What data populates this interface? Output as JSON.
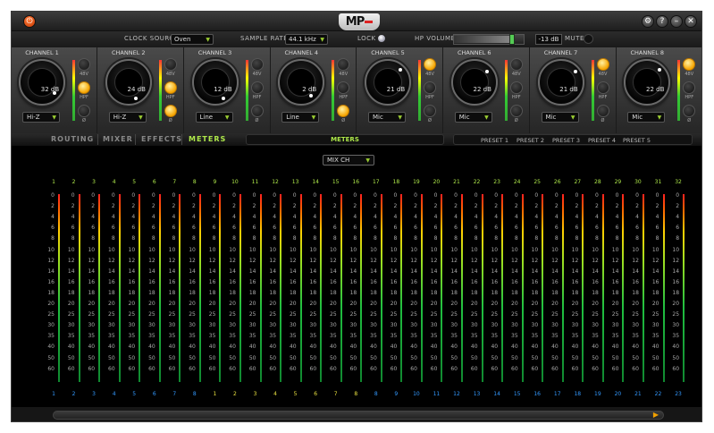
{
  "titlebar": {
    "logo": "MP",
    "buttons": [
      "gear-icon",
      "help-icon",
      "minimize-icon",
      "close-icon"
    ]
  },
  "settings": {
    "clock_source_label": "CLOCK SOURCE",
    "clock_source_value": "Oven",
    "sample_rate_label": "SAMPLE RATE",
    "sample_rate_value": "44.1 kHz",
    "lock_label": "LOCK",
    "hp_volume_label": "HP VOLUME",
    "hp_volume_value": "-13 dB",
    "mute_label": "MUTE"
  },
  "channels": [
    {
      "name": "CHANNEL 1",
      "gain": "32 dB",
      "input": "Hi-Z",
      "btn48v": false,
      "btnHpf": true,
      "btnPhase": false
    },
    {
      "name": "CHANNEL 2",
      "gain": "24 dB",
      "input": "Hi-Z",
      "btn48v": false,
      "btnHpf": true,
      "btnPhase": true
    },
    {
      "name": "CHANNEL 3",
      "gain": "12 dB",
      "input": "Line",
      "btn48v": false,
      "btnHpf": false,
      "btnPhase": false
    },
    {
      "name": "CHANNEL 4",
      "gain": "2 dB",
      "input": "Line",
      "btn48v": false,
      "btnHpf": false,
      "btnPhase": true
    },
    {
      "name": "CHANNEL 5",
      "gain": "21 dB",
      "input": "Mic",
      "btn48v": true,
      "btnHpf": false,
      "btnPhase": false
    },
    {
      "name": "CHANNEL 6",
      "gain": "22 dB",
      "input": "Mic",
      "btn48v": false,
      "btnHpf": false,
      "btnPhase": false
    },
    {
      "name": "CHANNEL 7",
      "gain": "21 dB",
      "input": "Mic",
      "btn48v": true,
      "btnHpf": false,
      "btnPhase": false
    },
    {
      "name": "CHANNEL 8",
      "gain": "22 dB",
      "input": "Mic",
      "btn48v": true,
      "btnHpf": false,
      "btnPhase": false
    }
  ],
  "channel_button_labels": {
    "phantom": "48V",
    "hpf": "HPF",
    "phase": "Ø"
  },
  "nav": {
    "tabs": [
      "ROUTING",
      "MIXER",
      "EFFECTS",
      "METERS"
    ],
    "active": "METERS",
    "view_title": "METERS",
    "presets": [
      "PRESET 1",
      "PRESET 2",
      "PRESET 3",
      "PRESET 4",
      "PRESET 5"
    ]
  },
  "meters": {
    "mix_select": "MIX CH",
    "column_numbers": [
      "1",
      "2",
      "3",
      "4",
      "5",
      "6",
      "7",
      "8",
      "9",
      "10",
      "11",
      "12",
      "13",
      "14",
      "15",
      "16",
      "17",
      "18",
      "19",
      "20",
      "21",
      "22",
      "23",
      "24",
      "25",
      "26",
      "27",
      "28",
      "29",
      "30",
      "31",
      "32"
    ],
    "scale": [
      "0",
      "2",
      "4",
      "6",
      "8",
      "10",
      "12",
      "14",
      "16",
      "18",
      "20",
      "25",
      "30",
      "35",
      "40",
      "50",
      "60"
    ],
    "bottom_labels": [
      "1",
      "2",
      "3",
      "4",
      "5",
      "6",
      "7",
      "8",
      "1",
      "2",
      "3",
      "4",
      "5",
      "6",
      "7",
      "8",
      "8",
      "9",
      "10",
      "11",
      "12",
      "13",
      "14",
      "15",
      "16",
      "17",
      "18",
      "19",
      "20",
      "21",
      "22",
      "23"
    ],
    "bottom_colors": [
      "#3399ff",
      "#3399ff",
      "#3399ff",
      "#3399ff",
      "#3399ff",
      "#3399ff",
      "#3399ff",
      "#3399ff",
      "#e8e040",
      "#e8e040",
      "#e8e040",
      "#e8e040",
      "#e8e040",
      "#e8e040",
      "#e8e040",
      "#e8e040",
      "#3399ff",
      "#3399ff",
      "#3399ff",
      "#3399ff",
      "#3399ff",
      "#3399ff",
      "#3399ff",
      "#3399ff",
      "#3399ff",
      "#3399ff",
      "#3399ff",
      "#3399ff",
      "#3399ff",
      "#3399ff",
      "#3399ff",
      "#3399ff"
    ]
  },
  "colors": {
    "accent_green": "#aee84a",
    "led_on": "#f5a400",
    "power": "#e04a0a"
  }
}
